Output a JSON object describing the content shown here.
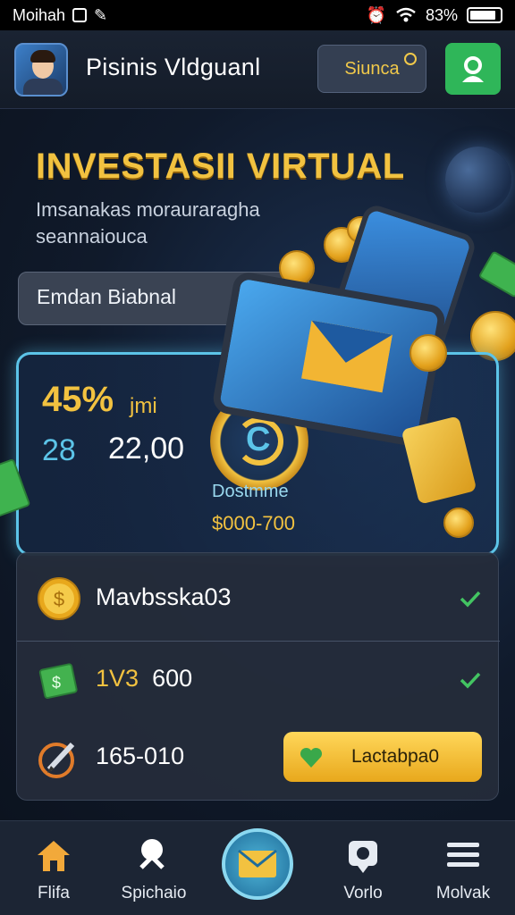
{
  "status_bar": {
    "carrier": "Moihah",
    "battery": "83%"
  },
  "header": {
    "title": "Pisinis Vldguanl",
    "sign_button": "Siunca"
  },
  "hero": {
    "title": "INVESTASII VIRTUAL",
    "subtitle": "Imsanakas morauraragha seannaiouca",
    "search_placeholder": "Emdan Biabnal"
  },
  "feature": {
    "rate": "45%",
    "rate_suffix": "jmi",
    "amount_prefix": "28",
    "amount": "22,00",
    "caption": "Dostmme",
    "range": "$000-700"
  },
  "list": {
    "items": [
      {
        "label": "Mavbsska03"
      },
      {
        "label_highlight": "1V3",
        "label": "600"
      },
      {
        "label": "165-010",
        "button": "Lactabpa0"
      }
    ]
  },
  "nav": {
    "items": [
      {
        "label": "Flifa"
      },
      {
        "label": "Spichaio"
      },
      {
        "label": "Vorlo"
      },
      {
        "label": "Molvak"
      }
    ]
  },
  "colors": {
    "accent_gold": "#f2c240",
    "accent_cyan": "#5cc4e8",
    "success_green": "#2fb659"
  }
}
